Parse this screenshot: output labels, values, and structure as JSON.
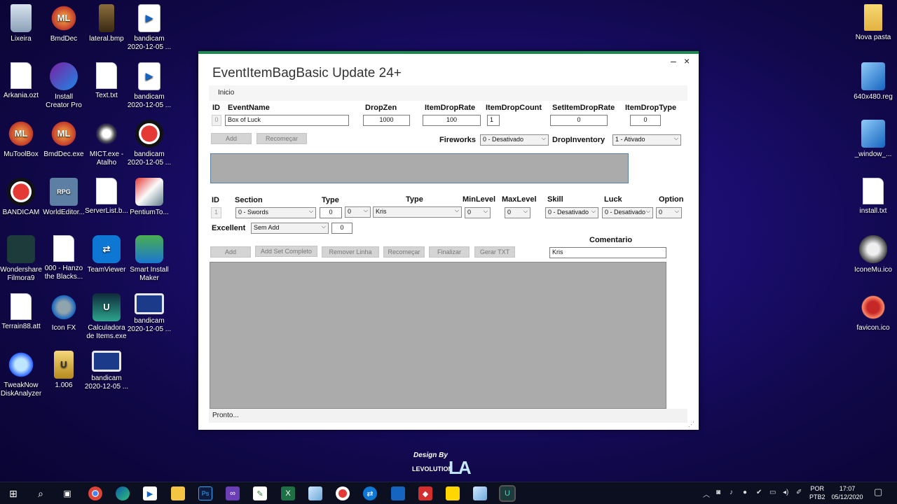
{
  "desktop_left": [
    {
      "label": "Lixeira",
      "icon": "recycle-bin-icon"
    },
    {
      "label": "BmdDec",
      "icon": "bmddec-icon"
    },
    {
      "label": "lateral.bmp",
      "icon": "bmp-file-icon"
    },
    {
      "label": "bandicam\n2020-12-05 ...",
      "icon": "video-file-icon"
    },
    {
      "label": "Arkania.ozt",
      "icon": "file-icon"
    },
    {
      "label": "Install\nCreator Pro",
      "icon": "install-creator-icon"
    },
    {
      "label": "Text.txt",
      "icon": "text-file-icon"
    },
    {
      "label": "bandicam\n2020-12-05 ...",
      "icon": "video-file-icon"
    },
    {
      "label": "MuToolBox",
      "icon": "mutoolbox-icon"
    },
    {
      "label": "BmdDec.exe",
      "icon": "bmddec-icon"
    },
    {
      "label": "MICT.exe -\nAtalho",
      "icon": "mict-icon"
    },
    {
      "label": "bandicam\n2020-12-05 ...",
      "icon": "bandicam-icon"
    },
    {
      "label": "BANDICAM",
      "icon": "bandicam-icon"
    },
    {
      "label": "WorldEditor...",
      "icon": "rpg-icon"
    },
    {
      "label": "ServerList.b...",
      "icon": "file-icon"
    },
    {
      "label": "PentiumTo...",
      "icon": "tools-icon"
    },
    {
      "label": "Wondershare\nFilmora9",
      "icon": "filmora-icon"
    },
    {
      "label": "000 - Hanzo\nthe Blacks...",
      "icon": "text-file-icon"
    },
    {
      "label": "TeamViewer",
      "icon": "teamviewer-icon"
    },
    {
      "label": "Smart Install\nMaker",
      "icon": "smart-install-icon"
    },
    {
      "label": "Terrain88.att",
      "icon": "file-icon"
    },
    {
      "label": "Icon FX",
      "icon": "iconfx-icon"
    },
    {
      "label": "Calculadora\nde Items.exe",
      "icon": "calculator-icon"
    },
    {
      "label": "bandicam\n2020-12-05 ...",
      "icon": "film-icon"
    },
    {
      "label": "TweakNow\nDiskAnalyzer",
      "icon": "disk-icon"
    },
    {
      "label": "1.006",
      "icon": "archive-icon"
    },
    {
      "label": "bandicam\n2020-12-05 ...",
      "icon": "film-icon"
    }
  ],
  "desktop_right": [
    {
      "label": "Nova pasta",
      "icon": "folder-icon"
    },
    {
      "label": "640x480.reg",
      "icon": "registry-icon"
    },
    {
      "label": "_window_...",
      "icon": "registry-icon"
    },
    {
      "label": "install.txt",
      "icon": "text-file-icon"
    },
    {
      "label": "IconeMu.ico",
      "icon": "mu-icon"
    },
    {
      "label": "favicon.ico",
      "icon": "mu-red-icon"
    }
  ],
  "window": {
    "title": "EventItemBagBasic Update 24+",
    "minimize": "–",
    "close": "×",
    "menu": "Inicio",
    "top_headers": {
      "id": "ID",
      "event_name": "EventName",
      "drop_zen": "DropZen",
      "item_drop_rate": "ItemDropRate",
      "item_drop_count": "ItemDropCount",
      "set_item_drop_rate": "SetItemDropRate",
      "item_drop_type": "ItemDropType"
    },
    "top_values": {
      "id": "0",
      "event_name": "Box of Luck",
      "drop_zen": "1000",
      "item_drop_rate": "100",
      "item_drop_count": "1",
      "set_item_drop_rate": "0",
      "item_drop_type": "0"
    },
    "add": "Add",
    "recomecar": "Recomeçar",
    "fireworks_label": "Fireworks",
    "fireworks_value": "0 - Desativado",
    "drop_inventory_label": "DropInventory",
    "drop_inventory_value": "1 - Ativado",
    "item_headers": {
      "id": "ID",
      "section": "Section",
      "type1": "Type",
      "type2": "Type",
      "min_level": "MinLevel",
      "max_level": "MaxLevel",
      "skill": "Skill",
      "luck": "Luck",
      "option": "Option"
    },
    "item_values": {
      "id": "1",
      "section": "0 - Swords",
      "type_num": "0",
      "type_sel": "0",
      "item": "Kris",
      "min_level": "0",
      "max_level": "0",
      "skill": "0 - Desativado",
      "luck": "0 - Desativado",
      "option": "0"
    },
    "excellent_label": "Excellent",
    "excellent_value": "Sem Add",
    "excellent_num": "0",
    "comentario_label": "Comentario",
    "comentario_value": "Kris",
    "buttons": {
      "add": "Add",
      "add_set": "Add Set Completo",
      "remover": "Remover Linha",
      "recomecar": "Recomeçar",
      "finalizar": "Finalizar",
      "gerar": "Gerar TXT"
    },
    "status": "Pronto..."
  },
  "logo": {
    "design": "Design By",
    "levolution": "LEVOLUTION",
    "mark": "LA"
  },
  "taskbar": {
    "lang1": "POR",
    "lang2": "PTB2",
    "time": "17:07",
    "date": "05/12/2020"
  }
}
